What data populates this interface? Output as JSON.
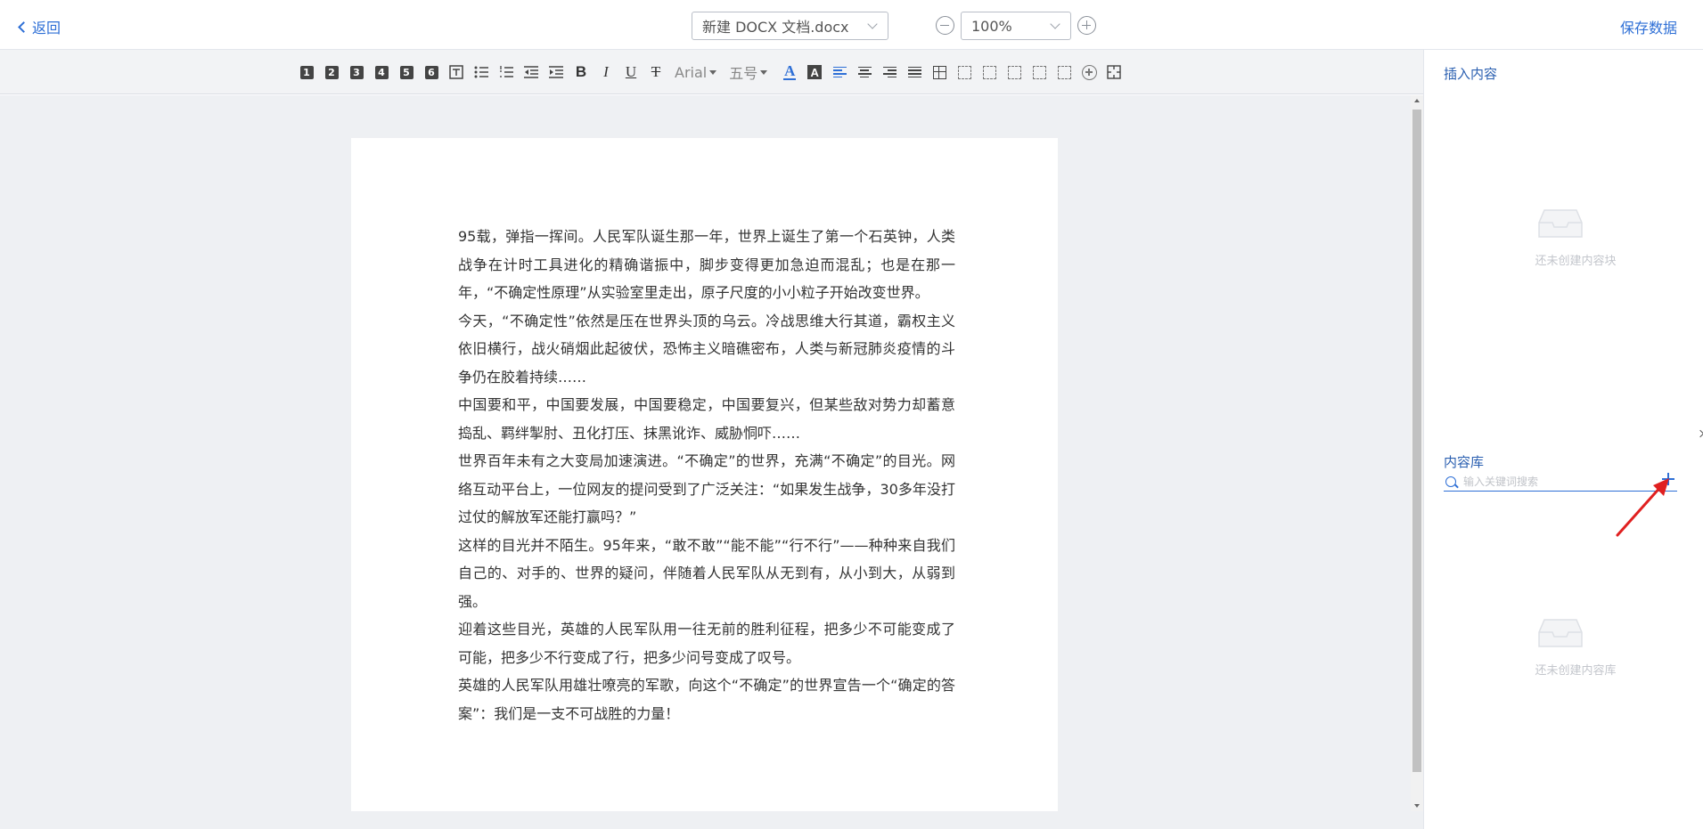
{
  "topbar": {
    "back_label": "返回",
    "file_name": "新建 DOCX 文档.docx",
    "zoom_value": "100%",
    "save_label": "保存数据"
  },
  "toolbar": {
    "heading_buttons": [
      "1",
      "2",
      "3",
      "4",
      "5",
      "6"
    ],
    "bold_label": "B",
    "italic_label": "I",
    "underline_label": "U",
    "strike_label": "T",
    "font_family": "Arial",
    "font_size": "五号",
    "text_color_label": "A",
    "bg_color_label": "A",
    "colors": {
      "accent": "#2e6fd6",
      "icon": "#444444"
    }
  },
  "document": {
    "paragraphs": [
      "95载，弹指一挥间。人民军队诞生那一年，世界上诞生了第一个石英钟，人类战争在计时工具进化的精确谐振中，脚步变得更加急迫而混乱；也是在那一年，“不确定性原理”从实验室里走出，原子尺度的小小粒子开始改变世界。",
      "今天，“不确定性”依然是压在世界头顶的乌云。冷战思维大行其道，霸权主义依旧横行，战火硝烟此起彼伏，恐怖主义暗礁密布，人类与新冠肺炎疫情的斗争仍在胶着持续……",
      "中国要和平，中国要发展，中国要稳定，中国要复兴，但某些敌对势力却蓄意捣乱、羁绊掣肘、丑化打压、抹黑讹诈、威胁恫吓……",
      "世界百年未有之大变局加速演进。“不确定”的世界，充满“不确定”的目光。网络互动平台上，一位网友的提问受到了广泛关注：“如果发生战争，30多年没打过仗的解放军还能打赢吗？”",
      "这样的目光并不陌生。95年来，“敢不敢”“能不能”“行不行”——种种来自我们自己的、对手的、世界的疑问，伴随着人民军队从无到有，从小到大，从弱到强。",
      "迎着这些目光，英雄的人民军队用一往无前的胜利征程，把多少不可能变成了可能，把多少不行变成了行，把多少问号变成了叹号。",
      "英雄的人民军队用雄壮嘹亮的军歌，向这个“不确定”的世界宣告一个“确定的答案”：我们是一支不可战胜的力量！"
    ]
  },
  "right_panel": {
    "insert_title": "插入内容",
    "insert_empty_text": "还未创建内容块",
    "library_title": "内容库",
    "search_placeholder": "输入关键词搜索",
    "library_empty_text": "还未创建内容库",
    "colors": {
      "title": "#2a5fb0",
      "annotation_arrow": "#e02020"
    }
  }
}
